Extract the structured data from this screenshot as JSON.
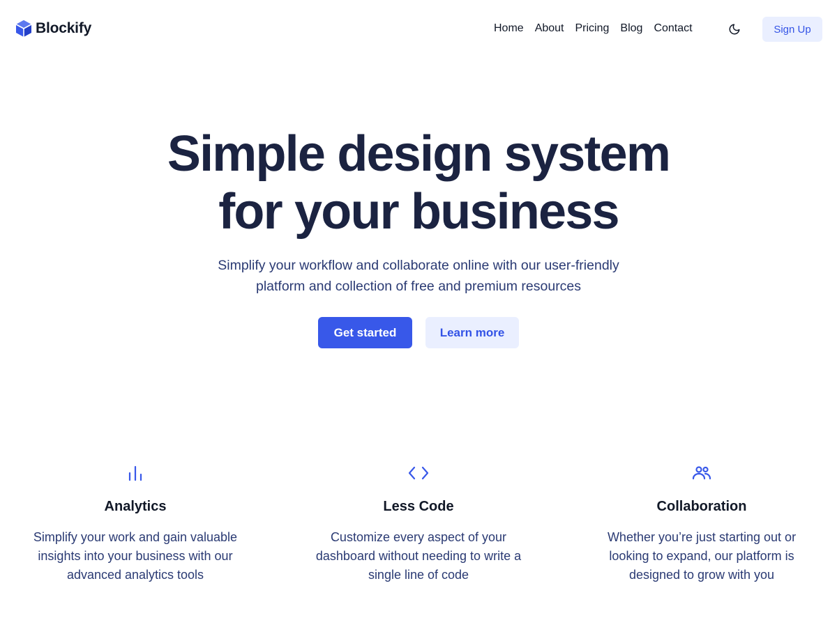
{
  "brand": {
    "name": "Blockify",
    "accent": "#3858e9",
    "accent_light": "#eaefff",
    "heading_color": "#1b2341",
    "body_color": "#2a3a73"
  },
  "nav": {
    "items": [
      {
        "label": "Home"
      },
      {
        "label": "About"
      },
      {
        "label": "Pricing"
      },
      {
        "label": "Blog"
      },
      {
        "label": "Contact"
      }
    ],
    "theme_icon": "moon-icon",
    "signup_label": "Sign Up"
  },
  "hero": {
    "title_line1": "Simple design system",
    "title_line2": "for your business",
    "subtitle_line1": "Simplify your workflow and collaborate online with our user-friendly",
    "subtitle_line2": "platform and collection of free and premium resources",
    "primary_label": "Get started",
    "secondary_label": "Learn more"
  },
  "features": [
    {
      "icon": "bar-chart-icon",
      "title": "Analytics",
      "text_lines": [
        "Simplify your work and gain valuable",
        "insights into your business with our",
        "advanced analytics tools"
      ]
    },
    {
      "icon": "code-icon",
      "title": "Less Code",
      "text_lines": [
        "Customize every aspect of your",
        "dashboard without needing to write a",
        "single line of code"
      ]
    },
    {
      "icon": "users-icon",
      "title": "Collaboration",
      "text_lines": [
        "Whether you’re just starting out or",
        "looking to expand, our platform is",
        "designed to grow with you"
      ]
    }
  ]
}
